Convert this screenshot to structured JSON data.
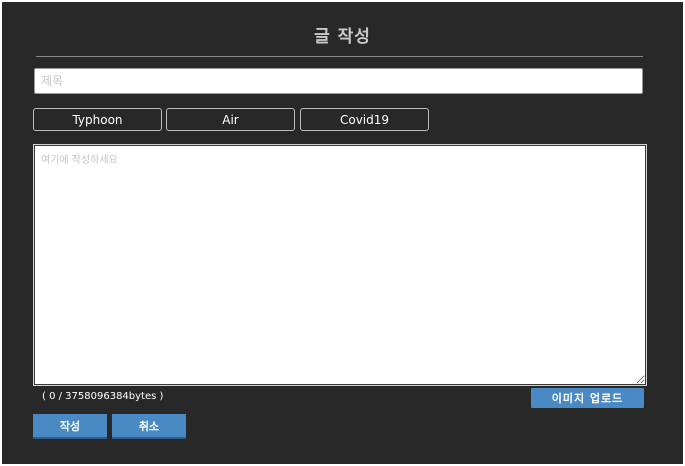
{
  "page": {
    "title": "글 작성"
  },
  "form": {
    "title_placeholder": "제목",
    "title_value": "",
    "content_placeholder": "여기에 작성하세요",
    "content_value": ""
  },
  "tags": [
    {
      "label": "Typhoon"
    },
    {
      "label": "Air"
    },
    {
      "label": "Covid19"
    }
  ],
  "counter": {
    "text": "( 0 / 3758096384bytes )"
  },
  "buttons": {
    "upload_label": "이미지 업로드",
    "submit_label": "작성",
    "cancel_label": "취소"
  },
  "colors": {
    "panel_bg": "#282828",
    "accent": "#4a8ac4"
  }
}
